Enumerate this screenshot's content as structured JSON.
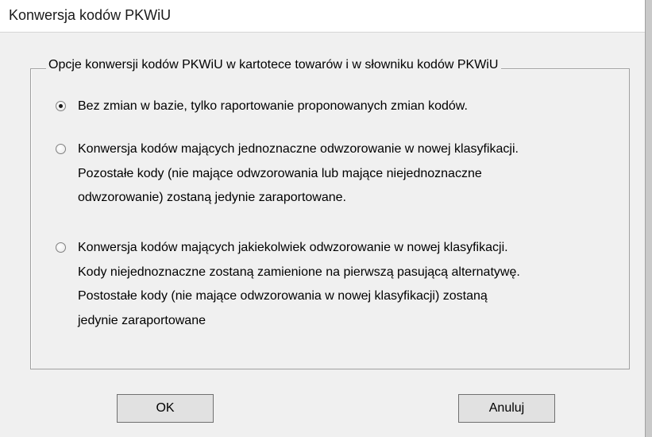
{
  "window": {
    "title": "Konwersja kodów PKWiU"
  },
  "group": {
    "label": "Opcje konwersji kodów PKWiU w kartotece towarów i w słowniku kodów PKWiU"
  },
  "options": [
    {
      "selected": true,
      "lines": [
        "Bez zmian w bazie, tylko raportowanie proponowanych zmian kodów."
      ]
    },
    {
      "selected": false,
      "lines": [
        "Konwersja kodów mających jednoznaczne odwzorowanie w nowej klasyfikacji.",
        "Pozostałe kody (nie mające odwzorowania lub mające niejednoznaczne",
        "odwzorowanie) zostaną jedynie zaraportowane."
      ]
    },
    {
      "selected": false,
      "lines": [
        "Konwersja kodów mających jakiekolwiek odwzorowanie w nowej klasyfikacji.",
        "Kody niejednoznaczne zostaną zamienione na pierwszą pasującą alternatywę.",
        "Postostałe kody (nie mające odwzorowania w nowej klasyfikacji) zostaną",
        "jedynie zaraportowane"
      ]
    }
  ],
  "buttons": {
    "ok": "OK",
    "cancel": "Anuluj"
  }
}
